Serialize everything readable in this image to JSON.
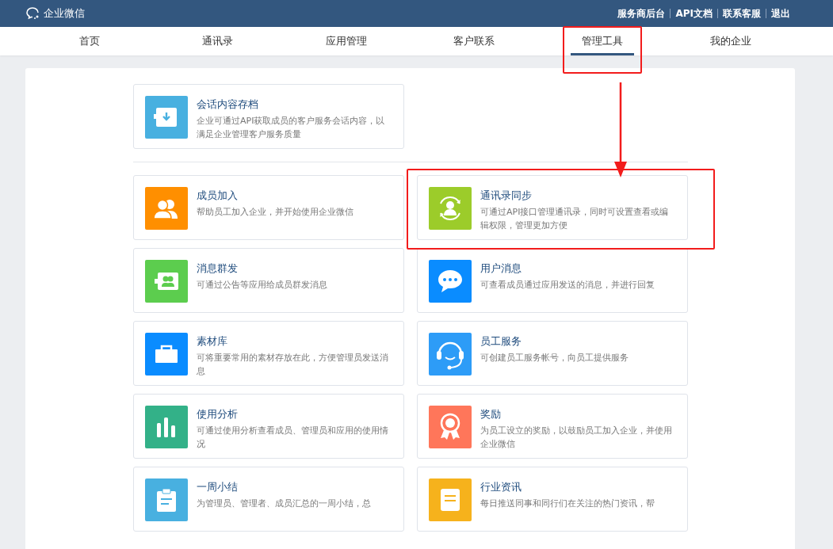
{
  "brand": {
    "name": "企业微信"
  },
  "top_links": [
    "服务商后台",
    "API文档",
    "联系客服",
    "退出"
  ],
  "nav": [
    {
      "label": "首页",
      "selected": false,
      "highlighted": false
    },
    {
      "label": "通讯录",
      "selected": false,
      "highlighted": false
    },
    {
      "label": "应用管理",
      "selected": false,
      "highlighted": false
    },
    {
      "label": "客户联系",
      "selected": false,
      "highlighted": false
    },
    {
      "label": "管理工具",
      "selected": true,
      "highlighted": true
    },
    {
      "label": "我的企业",
      "selected": false,
      "highlighted": false
    }
  ],
  "annotation_arrow": true,
  "featured": [
    {
      "kind": "archive",
      "color": "#48b0e0",
      "title": "会话内容存档",
      "desc": "企业可通过API获取成员的客户服务会话内容，以满足企业管理客户服务质量",
      "highlighted": false
    }
  ],
  "tools": [
    {
      "kind": "members",
      "color": "#ff8f00",
      "title": "成员加入",
      "desc": "帮助员工加入企业，并开始使用企业微信",
      "highlighted": false
    },
    {
      "kind": "sync",
      "color": "#9ccc2a",
      "title": "通讯录同步",
      "desc": "可通过API接口管理通讯录，同时可设置查看或编辑权限，管理更加方便",
      "highlighted": true
    },
    {
      "kind": "broadcast",
      "color": "#5ccd4e",
      "title": "消息群发",
      "desc": "可通过公告等应用给成员群发消息",
      "highlighted": false
    },
    {
      "kind": "chat",
      "color": "#0a8cff",
      "title": "用户消息",
      "desc": "可查看成员通过应用发送的消息，并进行回复",
      "highlighted": false
    },
    {
      "kind": "case",
      "color": "#0a8cff",
      "title": "素材库",
      "desc": "可将重要常用的素材存放在此，方便管理员发送消息",
      "highlighted": false
    },
    {
      "kind": "headset",
      "color": "#2d9cf7",
      "title": "员工服务",
      "desc": "可创建员工服务帐号，向员工提供服务",
      "highlighted": false
    },
    {
      "kind": "bars",
      "color": "#33b188",
      "title": "使用分析",
      "desc": "可通过使用分析查看成员、管理员和应用的使用情况",
      "highlighted": false
    },
    {
      "kind": "award",
      "color": "#ff765a",
      "title": "奖励",
      "desc": "为员工设立的奖励，以鼓励员工加入企业，并使用企业微信",
      "highlighted": false
    },
    {
      "kind": "clipboard",
      "color": "#48b0e0",
      "title": "一周小结",
      "desc": "为管理员、管理者、成员汇总的一周小结，总",
      "highlighted": false
    },
    {
      "kind": "news",
      "color": "#f6b21c",
      "title": "行业资讯",
      "desc": "每日推送同事和同行们在关注的热门资讯，帮",
      "highlighted": false
    }
  ]
}
